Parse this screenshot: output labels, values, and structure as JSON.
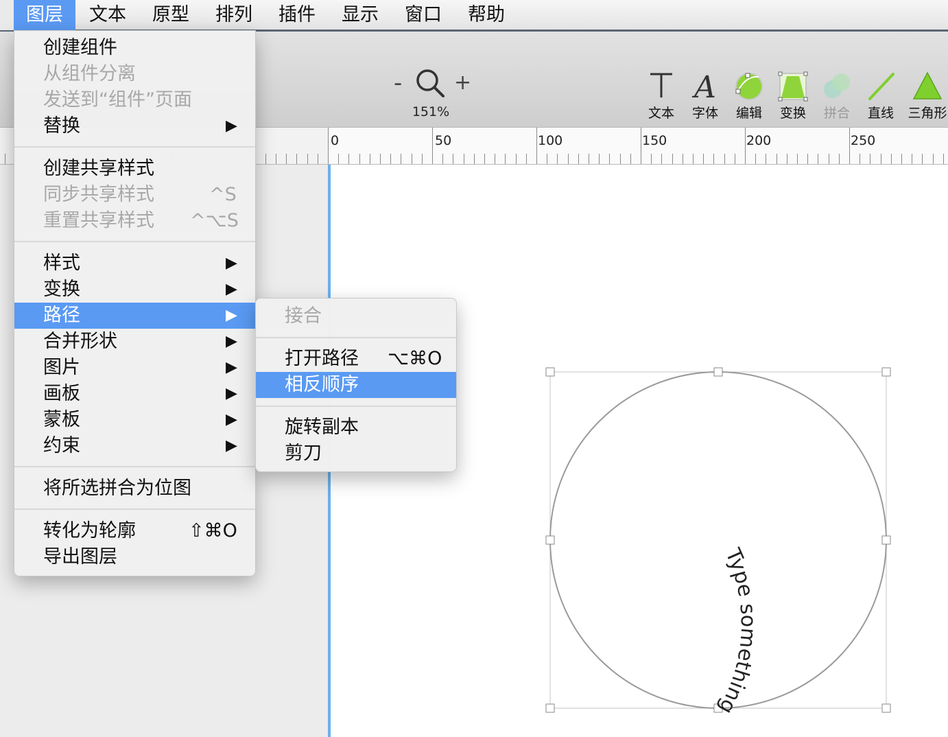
{
  "menubar": {
    "items": [
      "图层",
      "文本",
      "原型",
      "排列",
      "插件",
      "显示",
      "窗口",
      "帮助"
    ],
    "active_index": 0
  },
  "layer_menu": {
    "items": [
      {
        "label": "创建组件",
        "enabled": true
      },
      {
        "label": "从组件分离",
        "enabled": false
      },
      {
        "label": "发送到“组件”页面",
        "enabled": false
      },
      {
        "label": "替换",
        "enabled": true,
        "submenu": true
      },
      {
        "label": "创建共享样式",
        "enabled": true
      },
      {
        "label": "同步共享样式",
        "enabled": false,
        "shortcut": "^S"
      },
      {
        "label": "重置共享样式",
        "enabled": false,
        "shortcut": "^⌥S"
      },
      {
        "label": "样式",
        "enabled": true,
        "submenu": true
      },
      {
        "label": "变换",
        "enabled": true,
        "submenu": true
      },
      {
        "label": "路径",
        "enabled": true,
        "submenu": true,
        "highlighted": true
      },
      {
        "label": "合并形状",
        "enabled": true,
        "submenu": true
      },
      {
        "label": "图片",
        "enabled": true,
        "submenu": true
      },
      {
        "label": "画板",
        "enabled": true,
        "submenu": true
      },
      {
        "label": "蒙板",
        "enabled": true,
        "submenu": true
      },
      {
        "label": "约束",
        "enabled": true,
        "submenu": true
      },
      {
        "label": "将所选拼合为位图",
        "enabled": true
      },
      {
        "label": "转化为轮廓",
        "enabled": true,
        "shortcut": "⇧⌘O"
      },
      {
        "label": "导出图层",
        "enabled": true
      }
    ],
    "arrow_glyph": "▶"
  },
  "path_submenu": {
    "items": [
      {
        "label": "接合",
        "enabled": false
      },
      {
        "label": "打开路径",
        "enabled": true,
        "shortcut": "⌥⌘O"
      },
      {
        "label": "相反顺序",
        "enabled": true,
        "highlighted": true
      },
      {
        "label": "旋转副本",
        "enabled": true
      },
      {
        "label": "剪刀",
        "enabled": true
      }
    ]
  },
  "toolbar": {
    "zoom_minus": "-",
    "zoom_plus": "+",
    "zoom_level": "151%",
    "tools": [
      {
        "label": "文本",
        "icon": "text-tool-icon",
        "enabled": true
      },
      {
        "label": "字体",
        "icon": "font-tool-icon",
        "enabled": true
      },
      {
        "label": "编辑",
        "icon": "edit-tool-icon",
        "enabled": true
      },
      {
        "label": "变换",
        "icon": "transform-tool-icon",
        "enabled": true
      },
      {
        "label": "拼合",
        "icon": "flatten-tool-icon",
        "enabled": false
      },
      {
        "label": "直线",
        "icon": "line-tool-icon",
        "enabled": true
      },
      {
        "label": "三角形",
        "icon": "triangle-tool-icon",
        "enabled": true
      }
    ],
    "colors": {
      "green": "#7fcf2e",
      "green_dark": "#4b9a12"
    }
  },
  "ruler": {
    "labels": [
      "0",
      "50",
      "100",
      "150",
      "200",
      "250"
    ]
  },
  "canvas": {
    "curved_text": "Type something",
    "selection_color": "#a0a0a0",
    "guide_color": "#6ab0ec"
  },
  "colors": {
    "highlight": "#5a9af3",
    "disabled_text": "#a8a8a8"
  }
}
